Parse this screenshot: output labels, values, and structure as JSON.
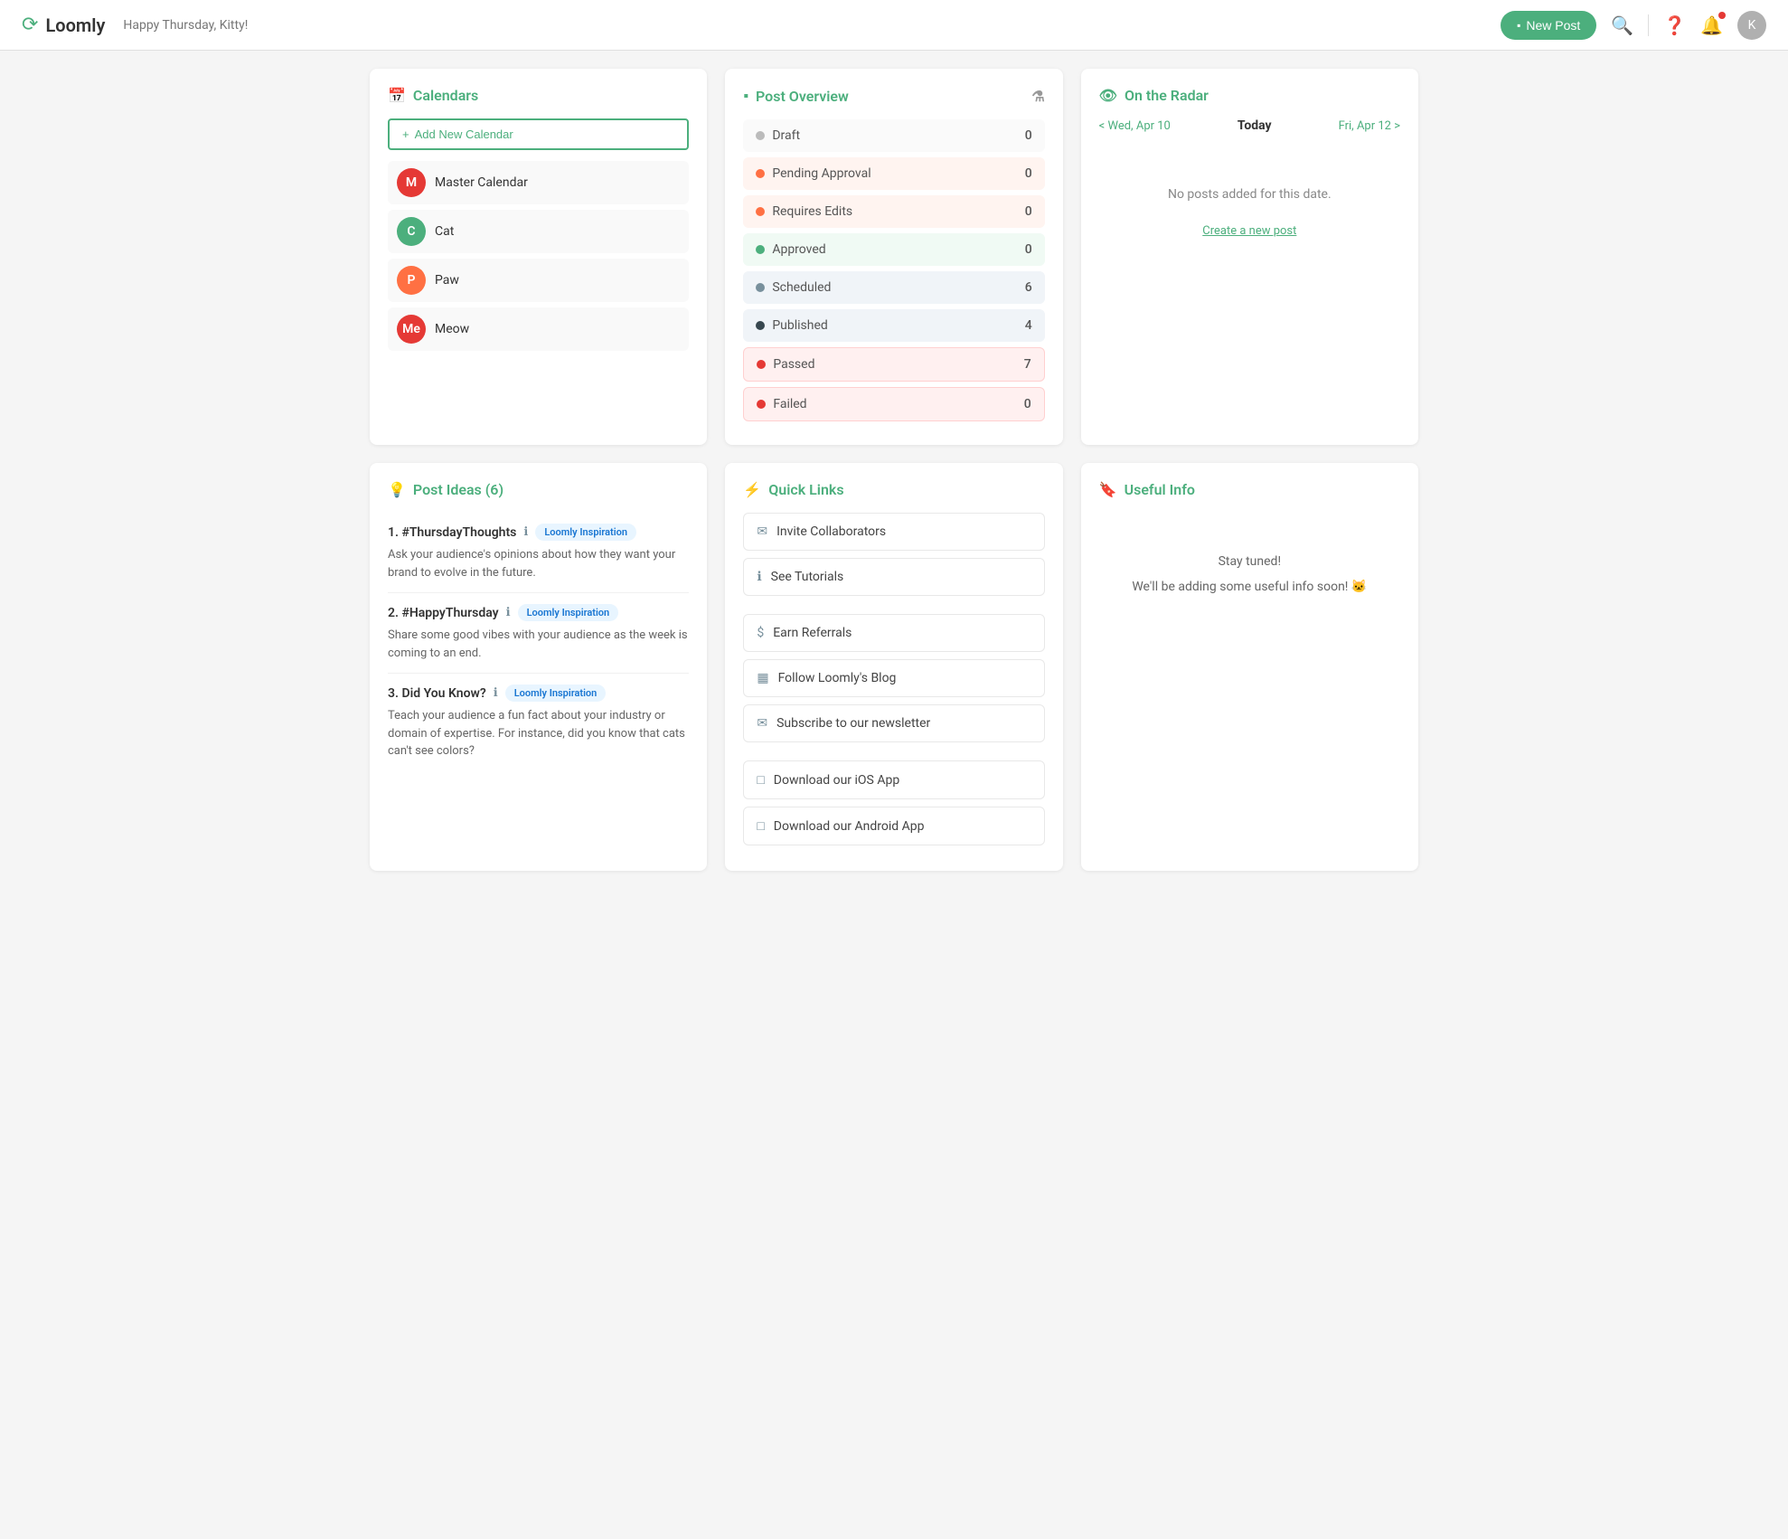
{
  "header": {
    "logo": "Loomly",
    "greeting": "Happy Thursday, Kitty!",
    "new_post_label": "New Post",
    "avatar_letter": "K"
  },
  "calendars": {
    "title": "Calendars",
    "add_button": "Add New Calendar",
    "items": [
      {
        "name": "Master Calendar",
        "color": "#e53935",
        "initials": "M"
      },
      {
        "name": "Cat",
        "color": "#4caf7d",
        "initials": "C"
      },
      {
        "name": "Paw",
        "color": "#ff7043",
        "initials": "P"
      },
      {
        "name": "Meow",
        "color": "#e53935",
        "initials": "Me"
      }
    ]
  },
  "post_overview": {
    "title": "Post Overview",
    "rows": [
      {
        "label": "Draft",
        "count": 0,
        "dot": "grey",
        "style": "draft"
      },
      {
        "label": "Pending Approval",
        "count": 0,
        "dot": "orange",
        "style": "pending"
      },
      {
        "label": "Requires Edits",
        "count": 0,
        "dot": "orange",
        "style": "requires"
      },
      {
        "label": "Approved",
        "count": 0,
        "dot": "green",
        "style": "approved"
      },
      {
        "label": "Scheduled",
        "count": 6,
        "dot": "steelblue",
        "style": "scheduled"
      },
      {
        "label": "Published",
        "count": 4,
        "dot": "darkblue",
        "style": "published"
      },
      {
        "label": "Passed",
        "count": 7,
        "dot": "pink",
        "style": "passed"
      },
      {
        "label": "Failed",
        "count": 0,
        "dot": "pink",
        "style": "failed"
      }
    ]
  },
  "on_the_radar": {
    "title": "On the Radar",
    "prev_label": "< Wed, Apr 10",
    "today_label": "Today",
    "next_label": "Fri, Apr 12 >",
    "empty_text": "No posts added for this date.",
    "create_link": "Create a new post"
  },
  "post_ideas": {
    "title": "Post Ideas (6)",
    "items": [
      {
        "number": 1,
        "title": "#ThursdayThoughts",
        "badge": "Loomly Inspiration",
        "description": "Ask your audience's opinions about how they want your brand to evolve in the future."
      },
      {
        "number": 2,
        "title": "#HappyThursday",
        "badge": "Loomly Inspiration",
        "description": "Share some good vibes with your audience as the week is coming to an end."
      },
      {
        "number": 3,
        "title": "Did You Know?",
        "badge": "Loomly Inspiration",
        "description": "Teach your audience a fun fact about your industry or domain of expertise. For instance, did you know that cats can't see colors?"
      }
    ]
  },
  "quick_links": {
    "title": "Quick Links",
    "items": [
      {
        "icon": "✉",
        "label": "Invite Collaborators",
        "group": 1
      },
      {
        "icon": "ℹ",
        "label": "See Tutorials",
        "group": 1
      },
      {
        "icon": "$",
        "label": "Earn Referrals",
        "group": 2
      },
      {
        "icon": "▦",
        "label": "Follow Loomly's Blog",
        "group": 2
      },
      {
        "icon": "✉",
        "label": "Subscribe to our newsletter",
        "group": 2
      },
      {
        "icon": "□",
        "label": "Download our iOS App",
        "group": 3
      },
      {
        "icon": "□",
        "label": "Download our Android App",
        "group": 3
      }
    ]
  },
  "useful_info": {
    "title": "Useful Info",
    "line1": "Stay tuned!",
    "line2": "We'll be adding some useful info soon! 🐱"
  }
}
